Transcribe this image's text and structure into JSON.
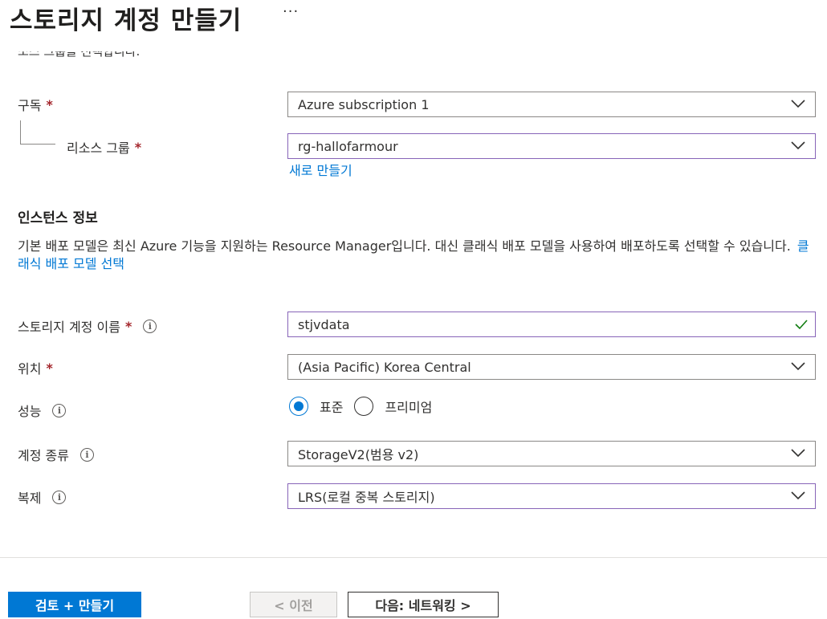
{
  "page": {
    "title": "스토리지 계정 만들기",
    "more_label": "···",
    "cutoff_text": "소스 그룹을 선택합니다."
  },
  "subscription": {
    "label": "구독",
    "required_mark": "*",
    "value": "Azure subscription 1"
  },
  "resource_group": {
    "label": "리소스 그룹",
    "required_mark": "*",
    "value": "rg-hallofarmour",
    "create_new_link": "새로 만들기"
  },
  "instance": {
    "section_title": "인스턴스 정보",
    "description": "기본 배포 모델은 최신 Azure 기능을 지원하는 Resource Manager입니다. 대신 클래식 배포 모델을 사용하여 배포하도록 선택할 수 있습니다.",
    "classic_link": "클래식 배포 모델 선택"
  },
  "storage_name": {
    "label": "스토리지 계정 이름",
    "required_mark": "*",
    "value": "stjvdata",
    "valid_icon": "check-icon"
  },
  "location": {
    "label": "위치",
    "required_mark": "*",
    "value": "(Asia Pacific) Korea Central"
  },
  "performance": {
    "label": "성능",
    "options": [
      "표준",
      "프리미엄"
    ],
    "selected": "표준"
  },
  "account_kind": {
    "label": "계정 종류",
    "value": "StorageV2(범용 v2)"
  },
  "replication": {
    "label": "복제",
    "value": "LRS(로컬 중복 스토리지)"
  },
  "footer": {
    "review_create": "검토 + 만들기",
    "previous": "< 이전",
    "next": "다음: 네트워킹 >"
  },
  "colors": {
    "accent": "#0078d4",
    "required": "#a4262c",
    "focus_border": "#8764b8",
    "valid": "#107c10"
  }
}
